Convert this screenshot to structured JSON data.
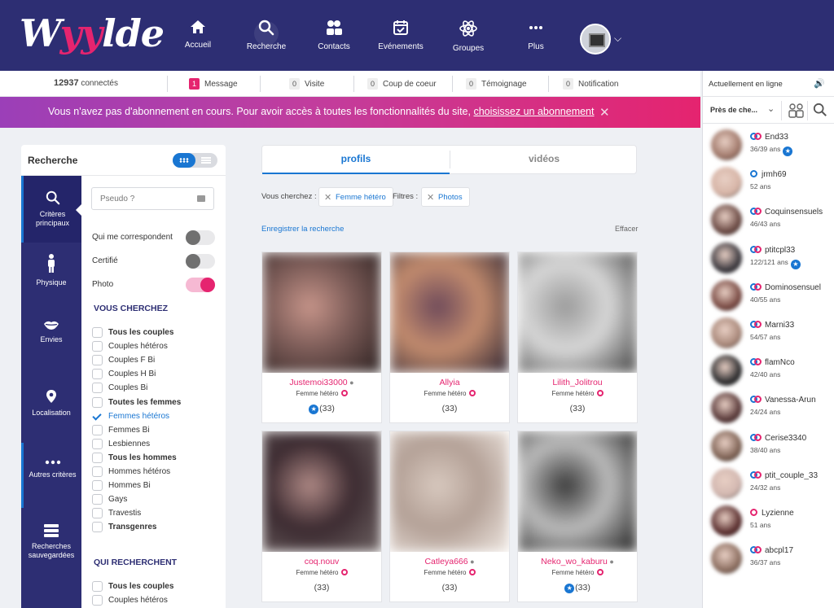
{
  "header": {
    "logo": "wyylde",
    "nav": [
      {
        "label": "Accueil",
        "icon": "home-icon"
      },
      {
        "label": "Recherche",
        "icon": "search-icon"
      },
      {
        "label": "Contacts",
        "icon": "contacts-icon"
      },
      {
        "label": "Evénements",
        "icon": "calendar-check-icon"
      },
      {
        "label": "Groupes",
        "icon": "atom-icon"
      },
      {
        "label": "Plus",
        "icon": "more-dots-icon"
      }
    ]
  },
  "stats": {
    "connected_count": "12937",
    "connected_label": "connectés",
    "items": [
      {
        "count": "1",
        "label": "Message"
      },
      {
        "count": "0",
        "label": "Visite"
      },
      {
        "count": "0",
        "label": "Coup de coeur"
      },
      {
        "count": "0",
        "label": "Témoignage"
      },
      {
        "count": "0",
        "label": "Notification"
      }
    ]
  },
  "banner": {
    "text": "Vous n'avez pas d'abonnement en cours. Pour avoir accès à toutes les fonctionnalités du site,",
    "link": "choisissez un abonnement",
    "close": "✕"
  },
  "search_panel": {
    "title": "Recherche",
    "side_nav": [
      {
        "label": "Critères principaux",
        "icon": "search-icon"
      },
      {
        "label": "Physique",
        "icon": "person-icon"
      },
      {
        "label": "Envies",
        "icon": "lips-icon"
      },
      {
        "label": "Localisation",
        "icon": "location-pin-icon"
      },
      {
        "label": "Autres critères",
        "icon": "more-dots-icon"
      },
      {
        "label": "Recherches sauvegardées",
        "icon": "saved-list-icon"
      }
    ],
    "pseudo_placeholder": "Pseudo ?",
    "toggles": [
      {
        "label": "Qui me correspondent",
        "on": false
      },
      {
        "label": "Certifié",
        "on": false
      },
      {
        "label": "Photo",
        "on": true
      }
    ],
    "section_you_search": "VOUS CHERCHEZ",
    "you_search_options": [
      {
        "label": "Tous les couples",
        "bold": true,
        "checked": false
      },
      {
        "label": "Couples hétéros",
        "bold": false,
        "checked": false
      },
      {
        "label": "Couples F Bi",
        "bold": false,
        "checked": false
      },
      {
        "label": "Couples H Bi",
        "bold": false,
        "checked": false
      },
      {
        "label": "Couples Bi",
        "bold": false,
        "checked": false
      },
      {
        "label": "Toutes les femmes",
        "bold": true,
        "checked": false
      },
      {
        "label": "Femmes hétéros",
        "bold": false,
        "checked": true
      },
      {
        "label": "Femmes Bi",
        "bold": false,
        "checked": false
      },
      {
        "label": "Lesbiennes",
        "bold": false,
        "checked": false
      },
      {
        "label": "Tous les hommes",
        "bold": true,
        "checked": false
      },
      {
        "label": "Hommes hétéros",
        "bold": false,
        "checked": false
      },
      {
        "label": "Hommes Bi",
        "bold": false,
        "checked": false
      },
      {
        "label": "Gays",
        "bold": false,
        "checked": false
      },
      {
        "label": "Travestis",
        "bold": false,
        "checked": false
      },
      {
        "label": "Transgenres",
        "bold": true,
        "checked": false
      }
    ],
    "section_who_search": "QUI RECHERCHENT",
    "who_search_options": [
      {
        "label": "Tous les couples",
        "bold": true,
        "checked": false
      },
      {
        "label": "Couples hétéros",
        "bold": false,
        "checked": false
      }
    ]
  },
  "results": {
    "tabs": [
      "profils",
      "vidéos"
    ],
    "you_search_label": "Vous cherchez :",
    "you_search_chip": "Femme hétéro",
    "filters_label": "Filtres :",
    "filters_chip": "Photos",
    "save_search": "Enregistrer la recherche",
    "clear": "Effacer",
    "profiles": [
      {
        "name": "Justemoi33000",
        "online_dot": true,
        "type": "Femme hétéro",
        "age": "(33)",
        "certified": true,
        "colors": [
          "#c7958a",
          "#7b5b57",
          "#2b2020"
        ]
      },
      {
        "name": "Allyia",
        "online_dot": false,
        "type": "Femme hétéro",
        "age": "(33)",
        "certified": false,
        "colors": [
          "#6e4a5a",
          "#c38c6e",
          "#2c2331"
        ]
      },
      {
        "name": "Lilith_Jolitrou",
        "online_dot": false,
        "type": "Femme hétéro",
        "age": "(33)",
        "certified": false,
        "colors": [
          "#9a9a9a",
          "#d8d8d8",
          "#3e3e3e"
        ]
      },
      {
        "name": "coq.nouv",
        "online_dot": false,
        "type": "Femme hétéro",
        "age": "(33)",
        "certified": false,
        "colors": [
          "#b08a86",
          "#3b2a30",
          "#6f6464"
        ]
      },
      {
        "name": "Catleya666",
        "online_dot": true,
        "type": "Femme hétéro",
        "age": "(33)",
        "certified": false,
        "colors": [
          "#d8c9bf",
          "#b3a096",
          "#efe7e1"
        ]
      },
      {
        "name": "Neko_wo_kaburu",
        "online_dot": true,
        "type": "Femme hétéro",
        "age": "(33)",
        "certified": true,
        "colors": [
          "#3a3a3a",
          "#bdbdbd",
          "#1a1a1a"
        ]
      }
    ]
  },
  "online_sidebar": {
    "title": "Actuellement en ligne",
    "filter_select": "Près de che...",
    "users": [
      {
        "name": "End33",
        "age": "36/39 ans",
        "kind": "couple",
        "certified": true,
        "color": "#a0786a"
      },
      {
        "name": "jrmh69",
        "age": "52 ans",
        "kind": "man",
        "certified": false,
        "color": "#d6b4a6"
      },
      {
        "name": "Coquinsensuels",
        "age": "46/43 ans",
        "kind": "couple",
        "certified": false,
        "color": "#6b4a44"
      },
      {
        "name": "ptitcpl33",
        "age": "122/121 ans",
        "kind": "couple",
        "certified": true,
        "color": "#3d3a40"
      },
      {
        "name": "Dominosensuel",
        "age": "40/55 ans",
        "kind": "couple",
        "certified": false,
        "color": "#7a4b44"
      },
      {
        "name": "Marni33",
        "age": "54/57 ans",
        "kind": "couple",
        "certified": false,
        "color": "#a9887a"
      },
      {
        "name": "flamNco",
        "age": "42/40 ans",
        "kind": "couple",
        "certified": false,
        "color": "#2e2e30"
      },
      {
        "name": "Vanessa-Arun",
        "age": "24/24 ans",
        "kind": "couple",
        "certified": false,
        "color": "#5a3a3a"
      },
      {
        "name": "Cerise3340",
        "age": "38/40 ans",
        "kind": "couple",
        "certified": false,
        "color": "#7f6355"
      },
      {
        "name": "ptit_couple_33",
        "age": "24/32 ans",
        "kind": "couple",
        "certified": false,
        "color": "#d2b7b0"
      },
      {
        "name": "Lyzienne",
        "age": "51 ans",
        "kind": "woman",
        "certified": false,
        "color": "#5a2e2e"
      },
      {
        "name": "abcpl17",
        "age": "36/37 ans",
        "kind": "couple",
        "certified": false,
        "color": "#8c6e60"
      }
    ]
  }
}
